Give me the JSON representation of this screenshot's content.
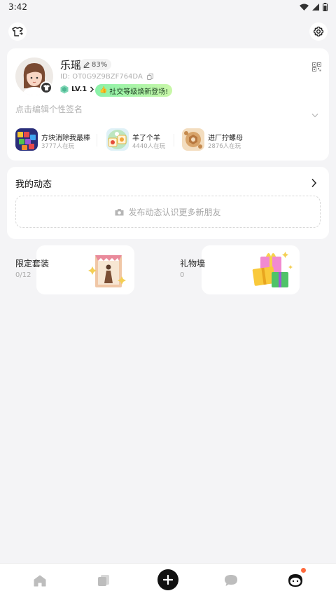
{
  "status_bar": {
    "time": "3:42"
  },
  "profile": {
    "name": "乐瑶",
    "match": "83%",
    "id_text": "ID: OT0G9Z9BZF764DA",
    "level": "LV.1",
    "level_tag": "社交等级焕新登场!",
    "signature_placeholder": "点击编辑个性签名"
  },
  "games": [
    {
      "name": "方块消除我最棒",
      "players": "3777人在玩"
    },
    {
      "name": "羊了个羊",
      "players": "4440人在玩"
    },
    {
      "name": "进厂拧螺母",
      "players": "2876人在玩"
    }
  ],
  "moments": {
    "title": "我的动态",
    "post_prompt": "发布动态认识更多新朋友"
  },
  "tiles": [
    {
      "label": "限定套装",
      "count": "0/12"
    },
    {
      "label": "礼物墙",
      "count": "0"
    }
  ],
  "icons": {
    "top_left": "wardrobe-swap-icon",
    "top_right": "settings-gear-icon",
    "tabs": [
      "home-icon",
      "cards-icon",
      "add-icon",
      "chat-icon",
      "profile-face-icon"
    ]
  },
  "colors": {
    "accent_dark": "#111111",
    "notification": "#ff6a3d",
    "level_tag_bg": "#8af2a8"
  }
}
